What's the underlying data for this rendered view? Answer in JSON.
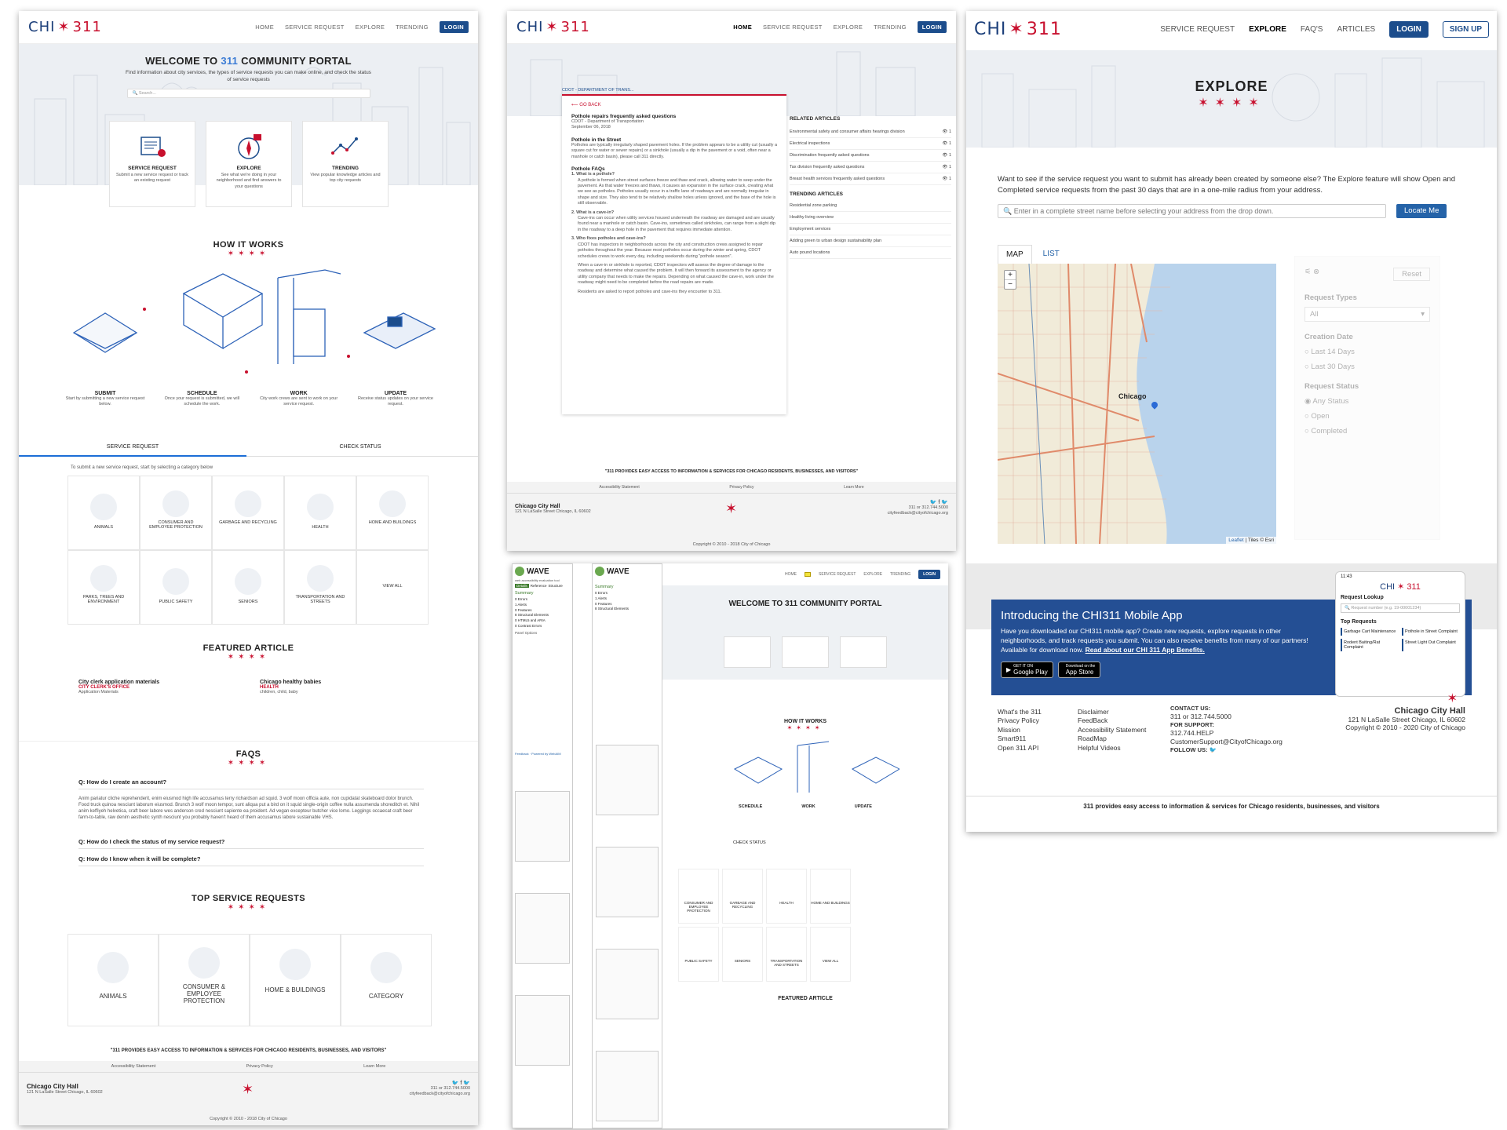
{
  "home": {
    "logo_text": "CHI",
    "logo_num": "311",
    "nav": [
      "HOME",
      "SERVICE REQUEST",
      "EXPLORE",
      "TRENDING"
    ],
    "login": "LOGIN",
    "welcome_pre": "WELCOME TO ",
    "welcome_num": "311",
    "welcome_post": " COMMUNITY PORTAL",
    "intro": "Find information about city services, the types of service requests you can make online, and check the status of service requests",
    "search_placeholder": "Search...",
    "cards": [
      {
        "title": "SERVICE REQUEST",
        "desc": "Submit a new service request or track an existing request"
      },
      {
        "title": "EXPLORE",
        "desc": "See what we're doing in your neighborhood and find answers to your questions"
      },
      {
        "title": "TRENDING",
        "desc": "View popular knowledge articles and top city requests"
      }
    ],
    "how_title": "HOW IT WORKS",
    "steps": [
      {
        "title": "SUBMIT",
        "desc": "Start by submitting a new service request below."
      },
      {
        "title": "SCHEDULE",
        "desc": "Once your request is submitted, we will schedule the work."
      },
      {
        "title": "WORK",
        "desc": "City work crews are sent to work on your service request."
      },
      {
        "title": "UPDATE",
        "desc": "Receive status updates on your service request."
      }
    ],
    "tabs": [
      "SERVICE REQUEST",
      "CHECK STATUS"
    ],
    "category_intro": "To submit a new service request, start by selecting a category below",
    "categories": [
      "ANIMALS",
      "CONSUMER AND EMPLOYEE PROTECTION",
      "GARBAGE AND RECYCLING",
      "HEALTH",
      "HOME AND BUILDINGS",
      "PARKS, TREES AND ENVIRONMENT",
      "PUBLIC SAFETY",
      "SENIORS",
      "TRANSPORTATION AND STREETS",
      "VIEW ALL"
    ],
    "featured_title": "FEATURED ARTICLE",
    "featured": [
      {
        "title": "City clerk application materials",
        "dept": "CITY CLERK'S OFFICE",
        "tags": "Application Materials"
      },
      {
        "title": "Chicago healthy babies",
        "dept": "HEALTH",
        "tags": "children, child, baby"
      }
    ],
    "faq_title": "FAQS",
    "faq_q1": "Q: How do I create an account?",
    "faq_a1": "Anim pariatur cliche reprehenderit, enim eiusmod high life accusamus terry richardson ad squid. 3 wolf moon officia aute, non cupidatat skateboard dolor brunch. Food truck quinoa nesciunt laborum eiusmod. Brunch 3 wolf moon tempor, sunt aliqua put a bird on it squid single-origin coffee nulla assumenda shoreditch et. Nihil anim keffiyeh helvetica, craft beer labore wes anderson cred nesciunt sapiente ea proident. Ad vegan excepteur butcher vice lomo. Leggings occaecat craft beer farm-to-table, raw denim aesthetic synth nesciunt you probably haven't heard of them accusamus labore sustainable VHS.",
    "faq_q2": "Q: How do I check the status of my service request?",
    "faq_q3": "Q: How do I know when it will be complete?",
    "top_title": "TOP SERVICE REQUESTS",
    "top": [
      "ANIMALS",
      "CONSUMER & EMPLOYEE PROTECTION",
      "HOME & BUILDINGS",
      "CATEGORY"
    ],
    "tagline": "\"311 PROVIDES EASY ACCESS TO INFORMATION & SERVICES FOR CHICAGO RESIDENTS, BUSINESSES, AND VISITORS\"",
    "footer_links": [
      "Accessibility Statement",
      "Privacy Policy",
      "Learn More"
    ],
    "city_hall": "Chicago City Hall",
    "address": "121 N LaSalle Street Chicago, IL 60602",
    "phone": "311 or 312.744.5000",
    "email": "cityfeedback@cityofchicago.org",
    "copyright": "Copyright © 2010 - 2018 City of Chicago",
    "social": "🐦 f 🐦"
  },
  "article": {
    "nav": [
      "HOME",
      "SERVICE REQUEST",
      "EXPLORE",
      "TRENDING"
    ],
    "login": "LOGIN",
    "breadcrumb": "CDOT - DEPARTMENT OF TRANS...",
    "back": "GO BACK",
    "title": "Pothole repairs frequently asked questions",
    "dept": "CDOT - Department of Transportation",
    "date": "September 06, 2018",
    "h1": "Pothole in the Street",
    "p1": "Potholes are typically irregularly shaped pavement holes. If the problem appears to be a utility cut (usually a square cut for water or sewer repairs) or a sinkhole (usually a dip in the pavement or a void, often near a manhole or catch basin), please call 311 directly.",
    "h2": "Pothole FAQs",
    "q1": "1. What is a pothole?",
    "a1": "A pothole is formed when street surfaces freeze and thaw and crack, allowing water to seep under the pavement. As that water freezes and thaws, it causes an expansion in the surface crack, creating what we see as potholes. Potholes usually occur in a traffic lane of roadways and are normally irregular in shape and size. They also tend to be relatively shallow holes unless ignored, and the base of the hole is still observable.",
    "q2": "2. What is a cave-in?",
    "a2": "Cave-ins can occur when utility services housed underneath the roadway are damaged and are usually found near a manhole or catch basin. Cave-ins, sometimes called sinkholes, can range from a slight dip in the roadway to a deep hole in the pavement that requires immediate attention.",
    "q3": "3. Who fixes potholes and cave-ins?",
    "a3": "CDOT has inspectors in neighborhoods across the city and construction crews assigned to repair potholes throughout the year. Because most potholes occur during the winter and spring, CDOT schedules crews to work every day, including weekends during \"pothole season\".",
    "a4": "When a cave-in or sinkhole is reported, CDOT inspectors will assess the degree of damage to the roadway and determine what caused the problem. It will then forward its assessment to the agency or utility company that needs to make the repairs. Depending on what caused the cave-in, work under the roadway might need to be completed before the road repairs are made.",
    "a5": "Residents are asked to report potholes and cave-ins they encounter to 311.",
    "related_title": "RELATED ARTICLES",
    "related": [
      {
        "t": "Environmental safety and consumer affairs hearings division",
        "n": "1"
      },
      {
        "t": "Electrical inspections",
        "n": "1"
      },
      {
        "t": "Discrimination frequently asked questions",
        "n": "1"
      },
      {
        "t": "Tax division frequently asked questions",
        "n": "1"
      },
      {
        "t": "Breast health services frequently asked questions",
        "n": "1"
      }
    ],
    "trending_title": "TRENDING ARTICLES",
    "trending": [
      "Residential zone parking",
      "Healthy living overview",
      "Employment services",
      "Adding green to urban design sustainability plan",
      "Auto pound locations"
    ],
    "tagline": "\"311 PROVIDES EASY ACCESS TO INFORMATION & SERVICES FOR CHICAGO RESIDENTS, BUSINESSES, AND VISITORS\"",
    "footer_links": [
      "Accessibility Statement",
      "Privacy Policy",
      "Learn More"
    ],
    "city_hall": "Chicago City Hall",
    "address": "121 N LaSalle Street Chicago, IL 60602",
    "phone": "311 or 312.744.5000",
    "email": "cityfeedback@cityofchicago.org",
    "copyright": "Copyright © 2010 - 2018 City of Chicago"
  },
  "explore": {
    "nav": [
      "SERVICE REQUEST",
      "EXPLORE",
      "FAQ'S",
      "ARTICLES"
    ],
    "login": "LOGIN",
    "signup": "SIGN UP",
    "title": "EXPLORE",
    "intro": "Want to see if the service request you want to submit has already been created by someone else? The Explore feature will show Open and Completed service requests from the past 30 days that are in a one-mile radius from your address.",
    "search_placeholder": "Enter in a complete street name before selecting your address from the drop down.",
    "locate": "Locate Me",
    "tabs": [
      "MAP",
      "LIST"
    ],
    "map_label": "Chicago",
    "attribution_link": "Leaflet",
    "attribution_rest": " | Tiles © Esri",
    "filter_request_types": "Request Types",
    "filter_select": "All",
    "filter_creation": "Creation Date",
    "filter_last14": "Last 14 Days",
    "filter_last30": "Last 30 Days",
    "filter_status": "Request Status",
    "filter_any": "Any Status",
    "filter_open": "Open",
    "filter_completed": "Completed",
    "reset": "Reset",
    "app_title": "Introducing the CHI311 Mobile App",
    "app_desc": "Have you downloaded our CHI311 mobile app? Create new requests, explore requests in other neighborhoods, and track requests you submit. You can also receive benefits from many of our partners! Available for download now.",
    "app_link": "Read about our CHI 311 App Benefits.",
    "google": "Google Play",
    "google_small": "GET IT ON",
    "apple": "App Store",
    "apple_small": "Download on the",
    "phone_time": "11:43",
    "phone_lookup": "Request Lookup",
    "phone_placeholder": "Request number (e.g. 19-00001234)",
    "phone_top": "Top Requests",
    "phone_items": [
      "Garbage Cart Maintenance",
      "Pothole in Street Complaint",
      "Rodent Baiting/Rat Complaint",
      "Street Light Out Complaint"
    ],
    "footer_col1": [
      "What's the 311",
      "Privacy Policy",
      "Mission",
      "Smart911",
      "Open 311 API"
    ],
    "footer_col2": [
      "Disclaimer",
      "FeedBack",
      "Accessibility Statement",
      "RoadMap",
      "Helpful Videos"
    ],
    "contact_label": "CONTACT US:",
    "contact_phone": "311 or 312.744.5000",
    "support_label": "FOR SUPPORT:",
    "support_phone": "312.744.HELP",
    "support_email": "CustomerSupport@CityofChicago.org",
    "follow": "FOLLOW US:",
    "city_hall": "Chicago City Hall",
    "address": "121 N LaSalle Street Chicago, IL 60602",
    "copyright": "Copyright © 2010 - 2020 City of Chicago",
    "tagline": "311 provides easy access to information & services for Chicago residents, businesses, and visitors"
  },
  "wave": {
    "title": "WAVE",
    "subtitle": "web accessibility evaluation tool",
    "tabs": [
      "Details",
      "Reference",
      "Structure"
    ],
    "summary": "Summary",
    "items": [
      "0 Errors",
      "1 Alerts",
      "0 Features",
      "8 Structural Elements",
      "0 HTML5 and ARIA",
      "0 Contrast Errors"
    ],
    "panel_options": "Panel Options",
    "welcome": "WELCOME TO 311 COMMUNITY PORTAL",
    "how": "HOW IT WORKS",
    "steps": [
      "SCHEDULE",
      "WORK",
      "UPDATE"
    ],
    "check_status": "CHECK STATUS",
    "featured": "FEATURED ARTICLE",
    "categories": [
      "CONSUMER AND EMPLOYEE PROTECTION",
      "GARBAGE AND RECYCLING",
      "HEALTH",
      "HOME AND BUILDINGS",
      "PUBLIC SAFETY",
      "SENIORS",
      "TRANSPORTATION AND STREETS",
      "VIEW ALL"
    ],
    "feedback": "Feedback · Powered by WebAIM"
  },
  "colors": {
    "brand_blue": "#1c4d8c",
    "brand_red": "#c8102e",
    "app_band": "#244f94"
  }
}
